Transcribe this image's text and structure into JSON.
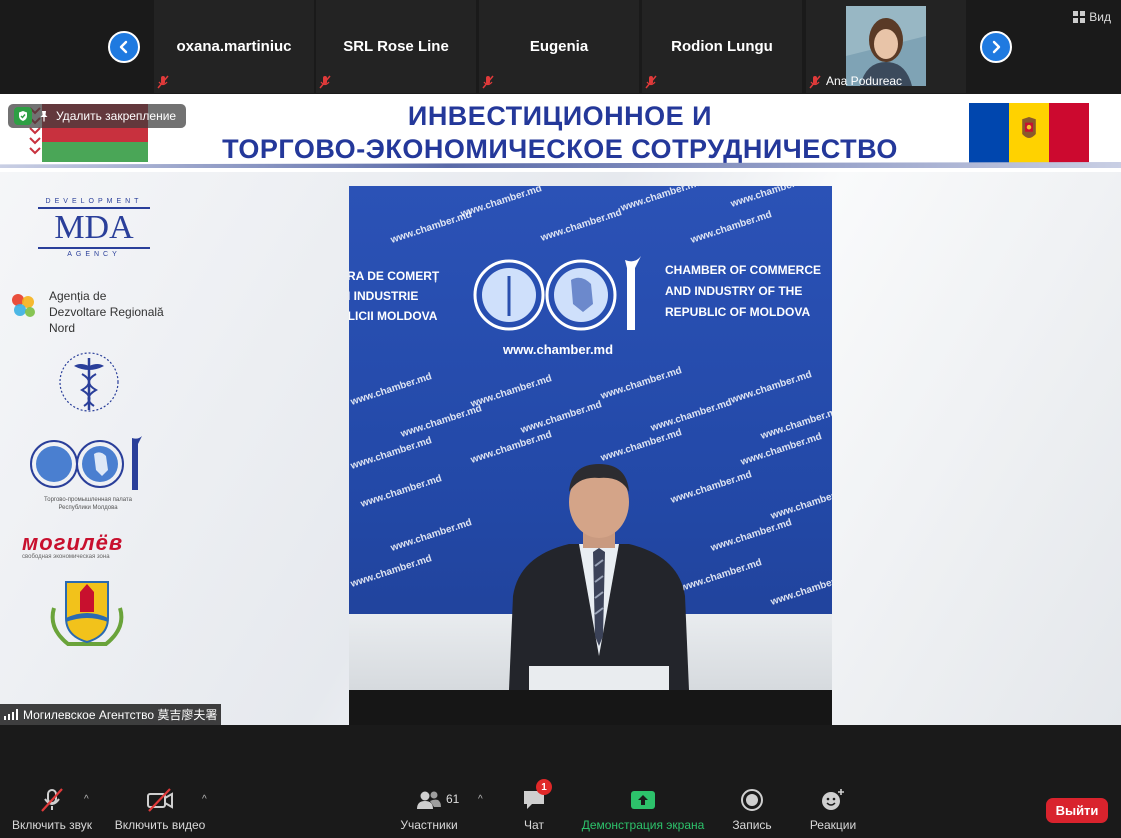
{
  "participants": {
    "tiles": [
      {
        "name": "oxana.martiniuc"
      },
      {
        "name": "SRL Rose Line"
      },
      {
        "name": "Eugenia"
      },
      {
        "name": "Rodion Lungu"
      },
      {
        "name": "Ana Podureac"
      }
    ],
    "view_label": "Вид"
  },
  "share": {
    "unpin_label": "Удалить закрепление",
    "banner_title_line1": "ИНВЕСТИЦИОННОЕ И",
    "banner_title_line2": "ТОРГОВО-ЭКОНОМИЧЕСКОЕ СОТРУДНИЧЕСТВО",
    "logos": {
      "mda_top": "DEVELOPMENT",
      "mda_main": "MDA",
      "mda_bottom": "AGENCY",
      "adr_line1": "Agenția de",
      "adr_line2": "Dezvoltare Regională",
      "adr_line3": "Nord",
      "cci_caption_line1": "Торгово-промышленная палата",
      "cci_caption_line2": "Республики Молдова",
      "mog_word": "могилёв",
      "mog_sub": "свободная экономическая зона"
    },
    "video": {
      "ro_line1": "ERA DE COMERȚ",
      "ro_line2": "ȘI INDUSTRIE",
      "ro_line3": "BLICII MOLDOVA",
      "en_line1": "CHAMBER OF COMMERCE",
      "en_line2": "AND INDUSTRY OF THE",
      "en_line3": "REPUBLIC OF MOLDOVA",
      "url": "www.chamber.md",
      "watermark": "www.chamber.md"
    },
    "speaker_name": "Могилевское Агентство 莫吉廖夫署"
  },
  "toolbar": {
    "audio_label": "Включить звук",
    "video_label": "Включить видео",
    "participants_label": "Участники",
    "participants_count": "61",
    "chat_label": "Чат",
    "chat_badge": "1",
    "share_label": "Демонстрация экрана",
    "record_label": "Запись",
    "reactions_label": "Реакции",
    "leave_label": "Выйти"
  },
  "colors": {
    "accent_blue": "#1f7ae0",
    "share_green": "#2dc26b",
    "leave_red": "#d9232d",
    "banner_blue": "#24389a"
  }
}
